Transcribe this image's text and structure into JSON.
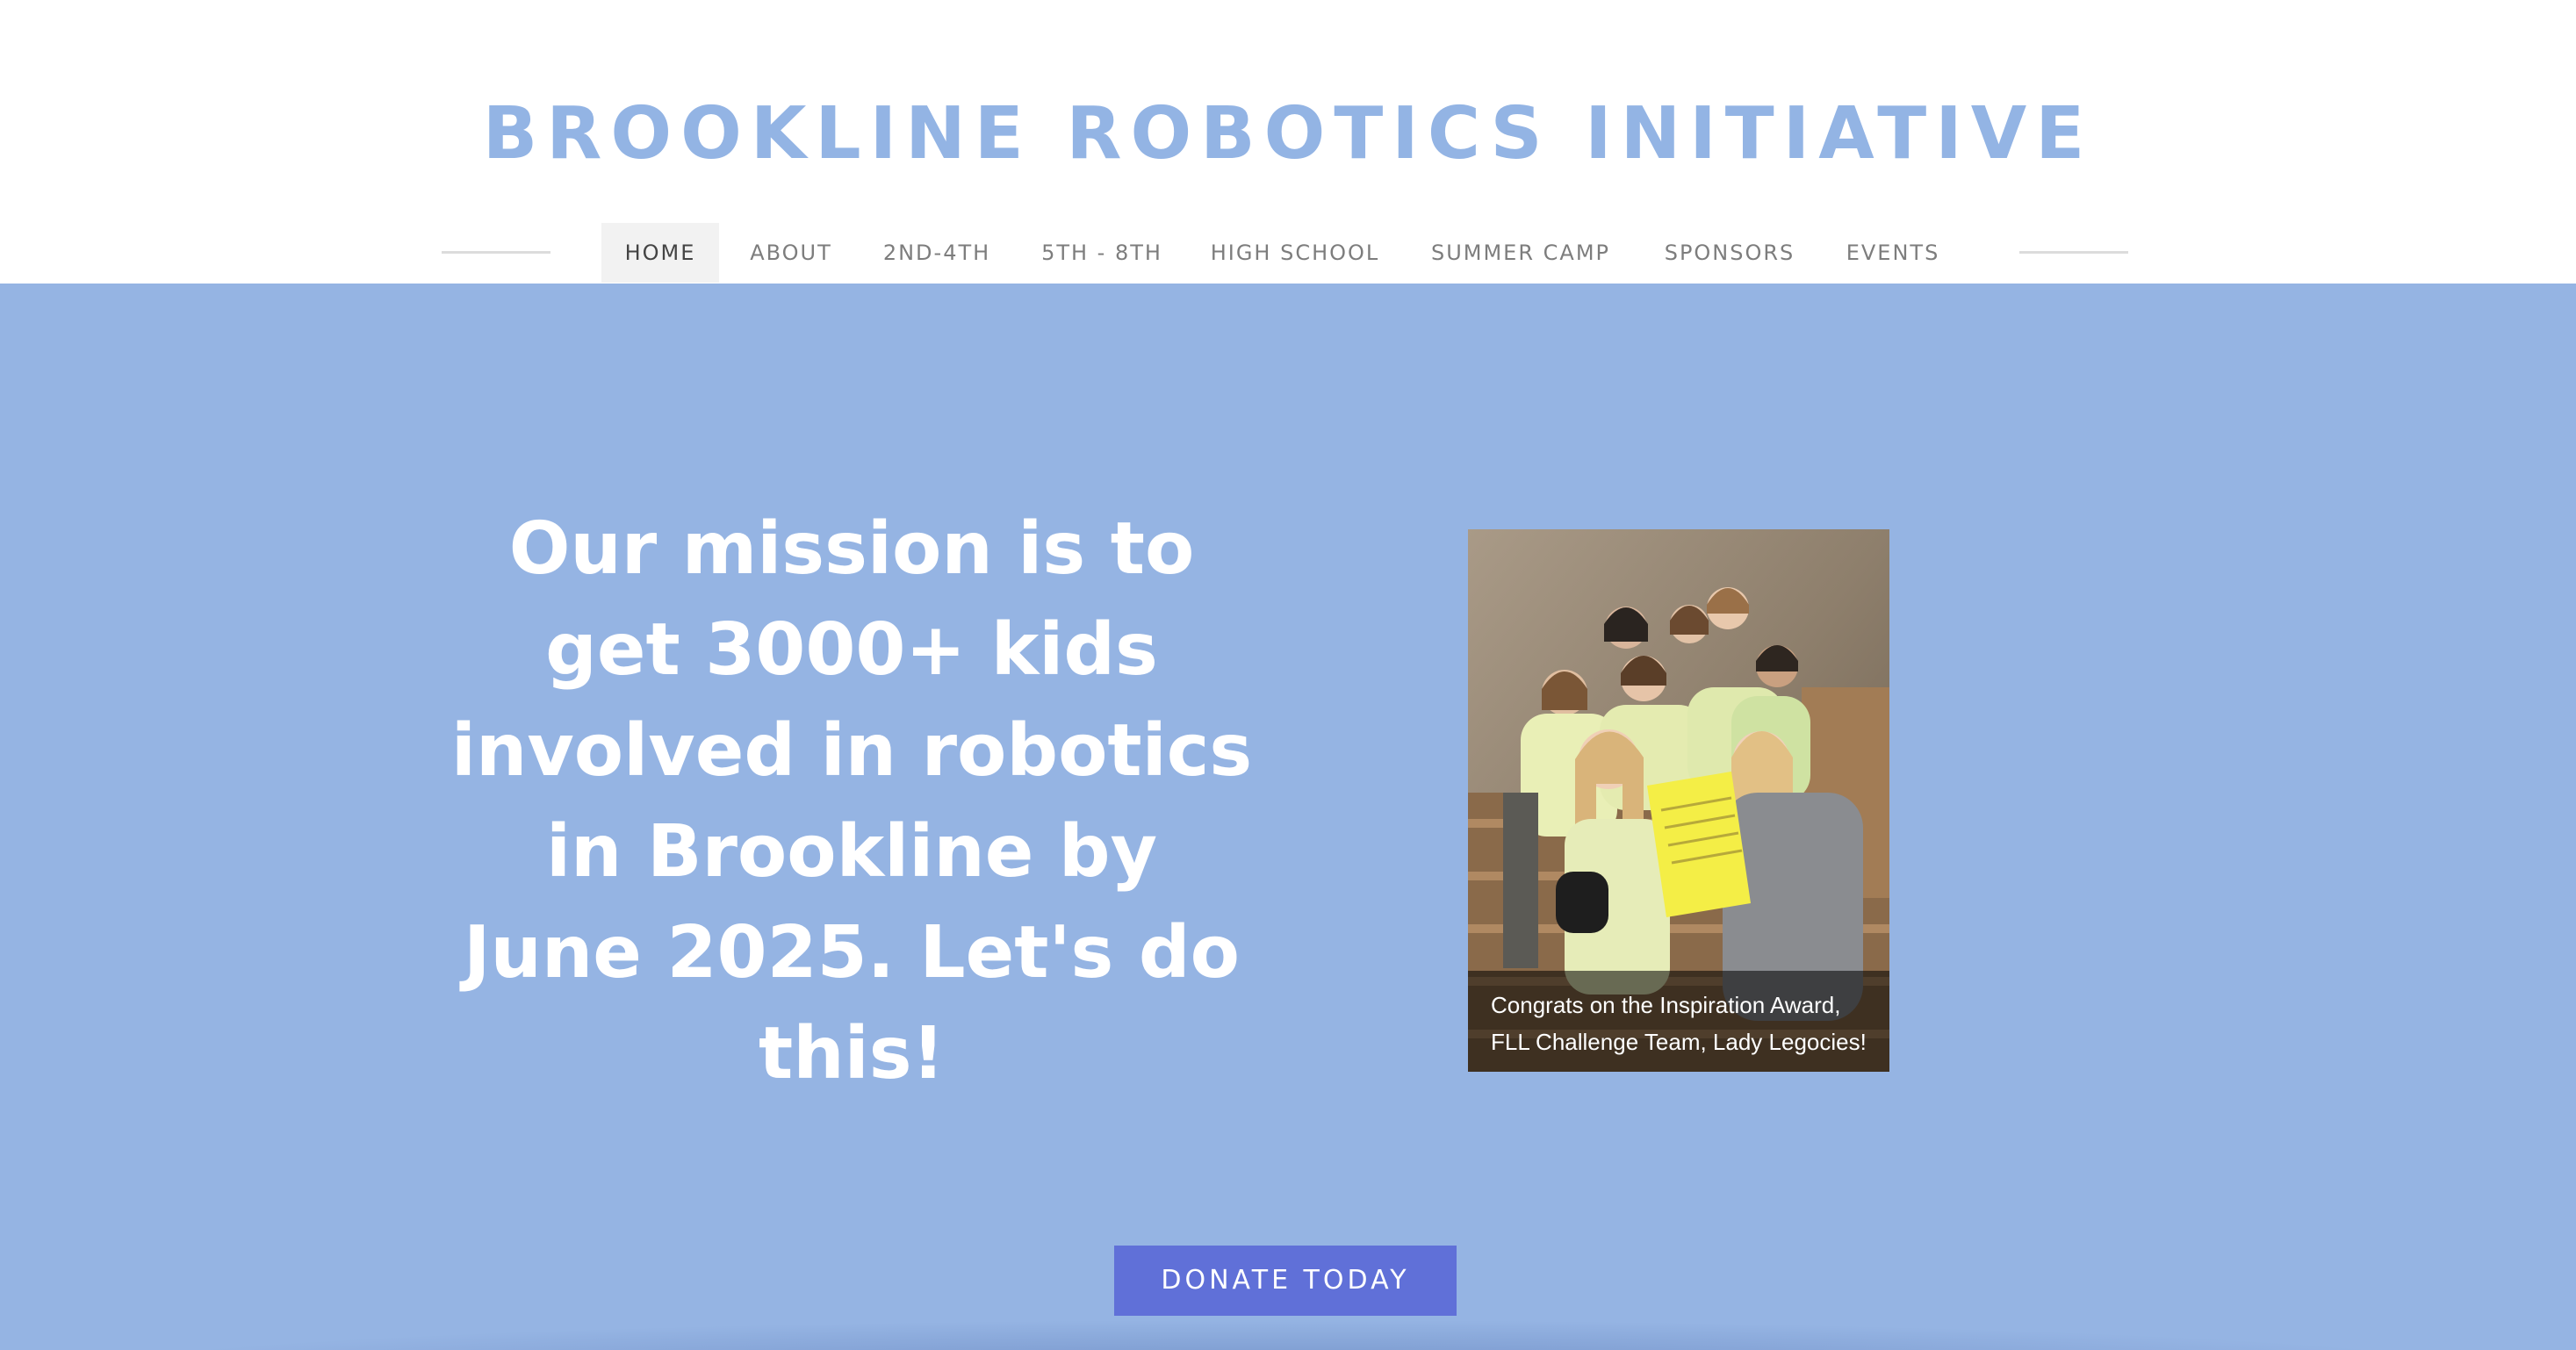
{
  "site": {
    "title": "BROOKLINE ROBOTICS INITIATIVE",
    "accent_color": "#93b4e4",
    "hero_color": "#95b4e3",
    "button_color": "#6070d8"
  },
  "nav": {
    "items": [
      {
        "label": "HOME",
        "active": true
      },
      {
        "label": "ABOUT",
        "active": false
      },
      {
        "label": "2ND-4TH",
        "active": false
      },
      {
        "label": "5TH - 8TH",
        "active": false
      },
      {
        "label": "HIGH SCHOOL",
        "active": false
      },
      {
        "label": "SUMMER CAMP",
        "active": false
      },
      {
        "label": "SPONSORS",
        "active": false
      },
      {
        "label": "EVENTS",
        "active": false
      }
    ]
  },
  "hero": {
    "mission_lines": [
      "Our mission is to",
      "get 3000+ kids",
      "involved in robotics",
      "in Brookline by",
      "June 2025. Let's do",
      "this!"
    ],
    "photo_caption_lines": [
      "Congrats on the Inspiration Award,",
      "FLL Challenge Team, Lady Legocies!"
    ],
    "donate_label": "DONATE TODAY"
  }
}
